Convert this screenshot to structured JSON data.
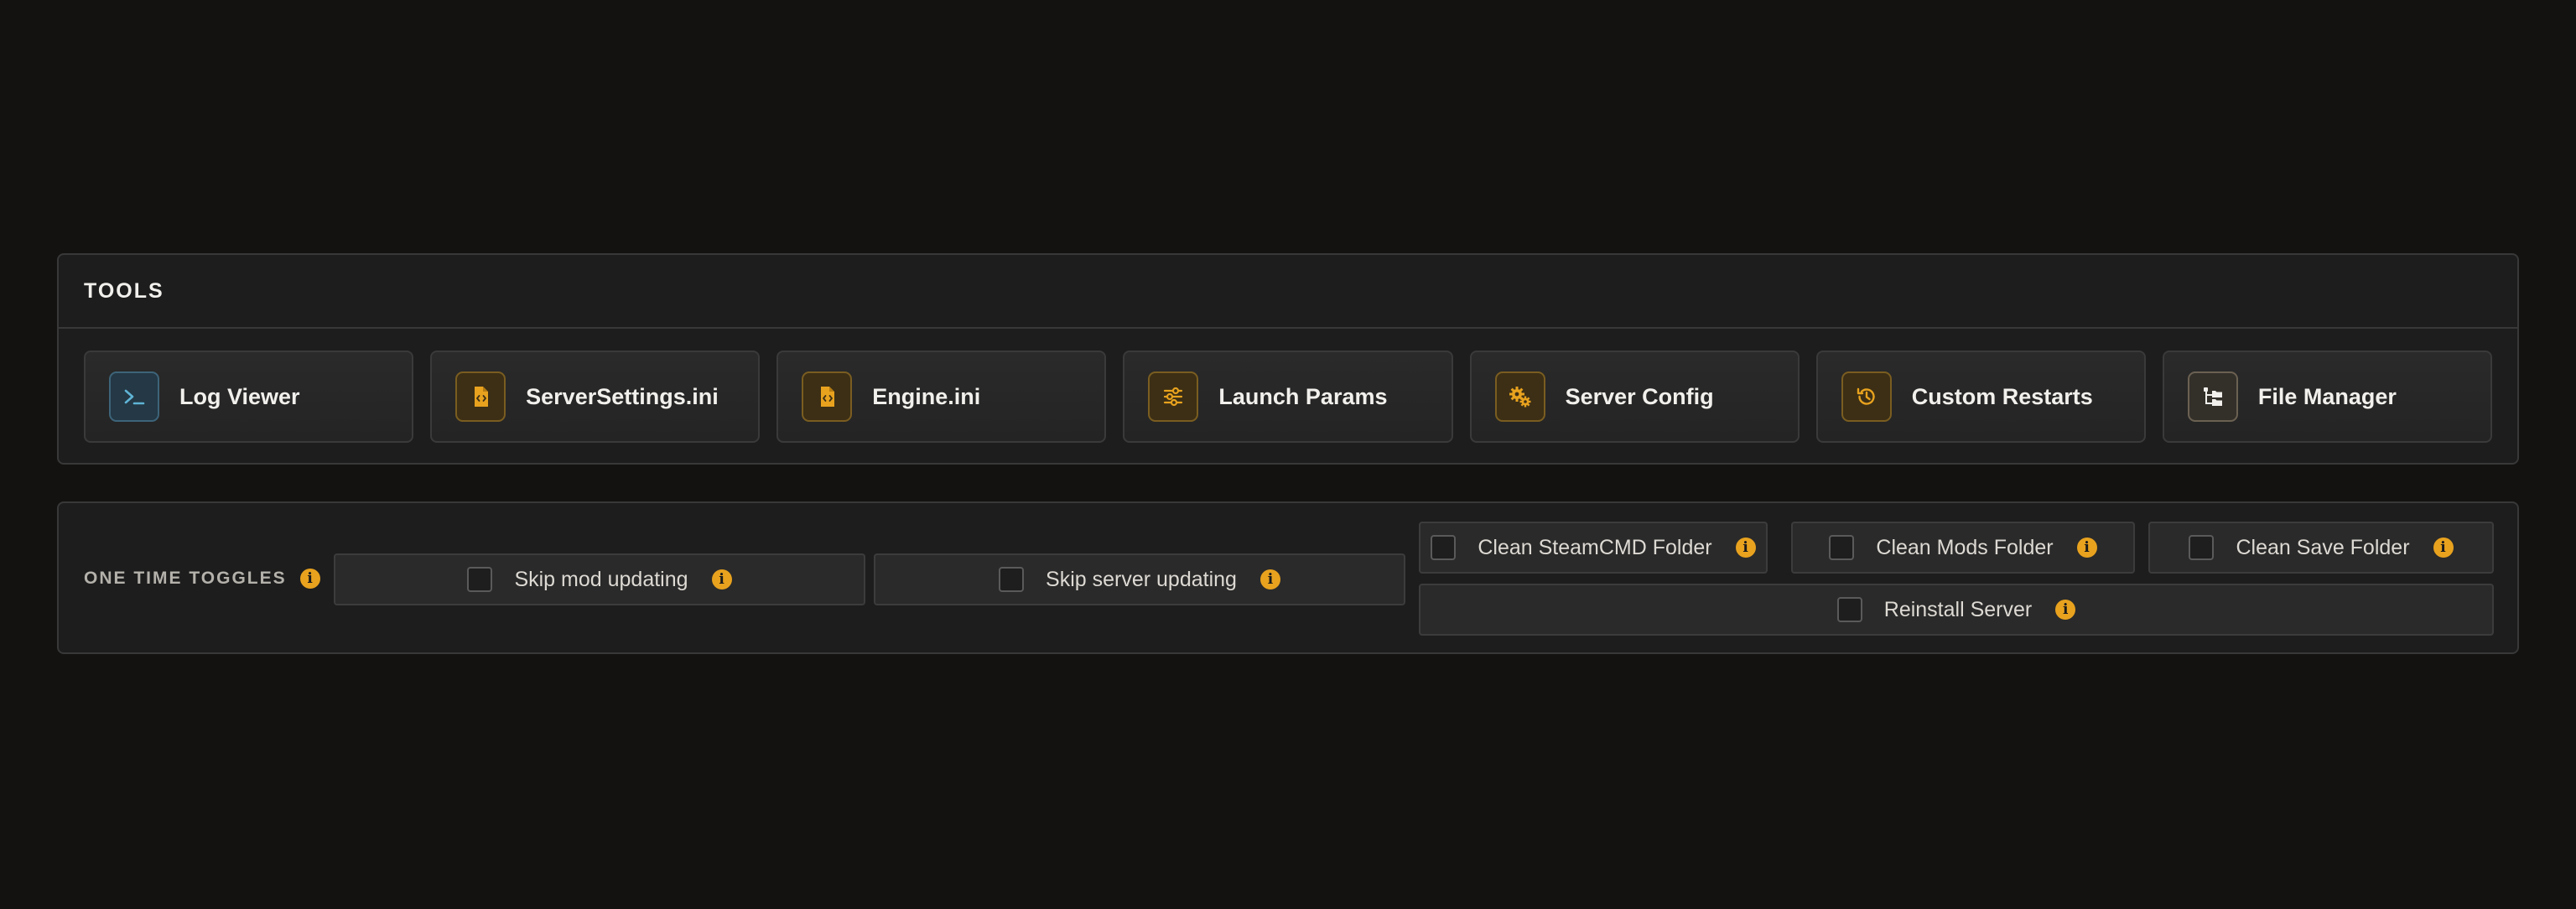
{
  "tools": {
    "title": "TOOLS",
    "items": [
      {
        "label": "Log Viewer",
        "icon": "terminal-icon",
        "accent": "#5fb4d6"
      },
      {
        "label": "ServerSettings.ini",
        "icon": "code-file-icon",
        "accent": "#e8a21e"
      },
      {
        "label": "Engine.ini",
        "icon": "code-file-icon",
        "accent": "#e8a21e"
      },
      {
        "label": "Launch Params",
        "icon": "sliders-icon",
        "accent": "#e8a21e"
      },
      {
        "label": "Server Config",
        "icon": "gears-icon",
        "accent": "#e8a21e"
      },
      {
        "label": "Custom Restarts",
        "icon": "history-icon",
        "accent": "#e8a21e"
      },
      {
        "label": "File Manager",
        "icon": "folder-tree-icon",
        "accent": "#f2f0ec"
      }
    ]
  },
  "toggles": {
    "title": "ONE TIME TOGGLES",
    "info_icon": "info-icon",
    "items": [
      {
        "label": "Skip mod updating",
        "checked": false
      },
      {
        "label": "Skip server updating",
        "checked": false
      },
      {
        "label": "Clean SteamCMD Folder",
        "checked": false
      },
      {
        "label": "Clean Mods Folder",
        "checked": false
      },
      {
        "label": "Clean Save Folder",
        "checked": false
      },
      {
        "label": "Reinstall Server",
        "checked": false
      }
    ]
  },
  "colors": {
    "background": "#131211",
    "panel": "#1d1d1d",
    "accent": "#e8a21e",
    "accent_blue": "#5fb4d6"
  }
}
